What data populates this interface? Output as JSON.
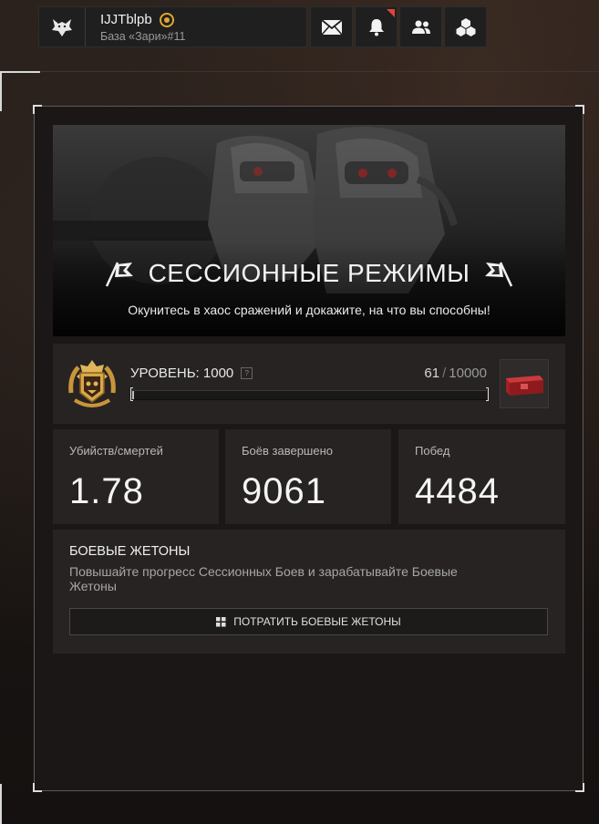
{
  "profile": {
    "name": "IJJTblpb",
    "base": "База «Зари»#11",
    "logo_icon": "wolf-icon",
    "rank_icon": "rank-star-icon"
  },
  "topbar": {
    "icons": [
      "mail-icon",
      "bell-icon",
      "friends-icon",
      "clan-icon"
    ],
    "notification_color": "#e0443a"
  },
  "banner": {
    "title": "СЕССИОННЫЕ РЕЖИМЫ",
    "subtitle": "Окунитесь в хаос сражений и докажите, на что вы способны!"
  },
  "level": {
    "label": "УРОВЕНЬ: 1000",
    "help": "?",
    "current": "61",
    "separator": "/",
    "max": "10000",
    "progress": 0.0061
  },
  "stats": [
    {
      "label": "Убийств/смертей",
      "value": "1.78"
    },
    {
      "label": "Боёв завершено",
      "value": "9061"
    },
    {
      "label": "Побед",
      "value": "4484"
    }
  ],
  "tokens": {
    "title": "БОЕВЫЕ ЖЕТОНЫ",
    "description": "Повышайте прогресс Сессионных Боев и зарабатывайте Боевые Жетоны",
    "button_label": "ПОТРАТИТЬ БОЕВЫЕ ЖЕТОНЫ"
  },
  "colors": {
    "accent_gold": "#e2a72e",
    "reward_red": "#b8262a"
  }
}
